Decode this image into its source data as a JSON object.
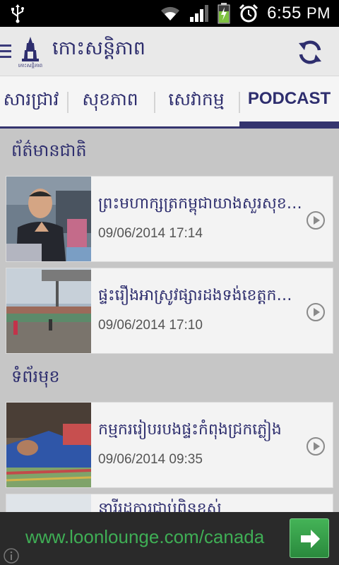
{
  "status_bar": {
    "time": "6:55",
    "ampm": "PM",
    "icons": [
      "usb-icon",
      "wifi-icon",
      "signal-icon",
      "battery-charging-icon",
      "alarm-icon"
    ]
  },
  "app": {
    "title": "កោះសន្តិភាព",
    "logo_caption": "កោះសន្តិភាព",
    "accent_color": "#2e2e6e"
  },
  "tabs": [
    {
      "label": "សារជ្រាវ"
    },
    {
      "label": "សុខភាព"
    },
    {
      "label": "សេវាកម្ម"
    },
    {
      "label": "PODCAST",
      "active": true
    }
  ],
  "sections": [
    {
      "title": "ព័ត៌មានជាតិ",
      "items": [
        {
          "headline": "ព្រះមហាក្សត្រកម្ពុជាយាងសួរសុខទុក្ខ",
          "date": "09/06/2014 17:14"
        },
        {
          "headline": "ផ្ទះរឿងអាស្រូវផ្សារដងទង់ខេត្តកណ្ដាល",
          "date": "09/06/2014 17:10"
        }
      ]
    },
    {
      "title": "ទំព័រមុខ",
      "items": [
        {
          "headline": "កម្មកររៀបរបងផ្ទះកំពុងជ្រកភ្លៀង",
          "date": "09/06/2014 09:35"
        },
        {
          "headline": "នារីរដ្ឋការជាប់ពិន្ទុខ្ពស់",
          "date": ""
        }
      ]
    }
  ],
  "ad": {
    "url": "www.loonlounge.com/canada"
  }
}
